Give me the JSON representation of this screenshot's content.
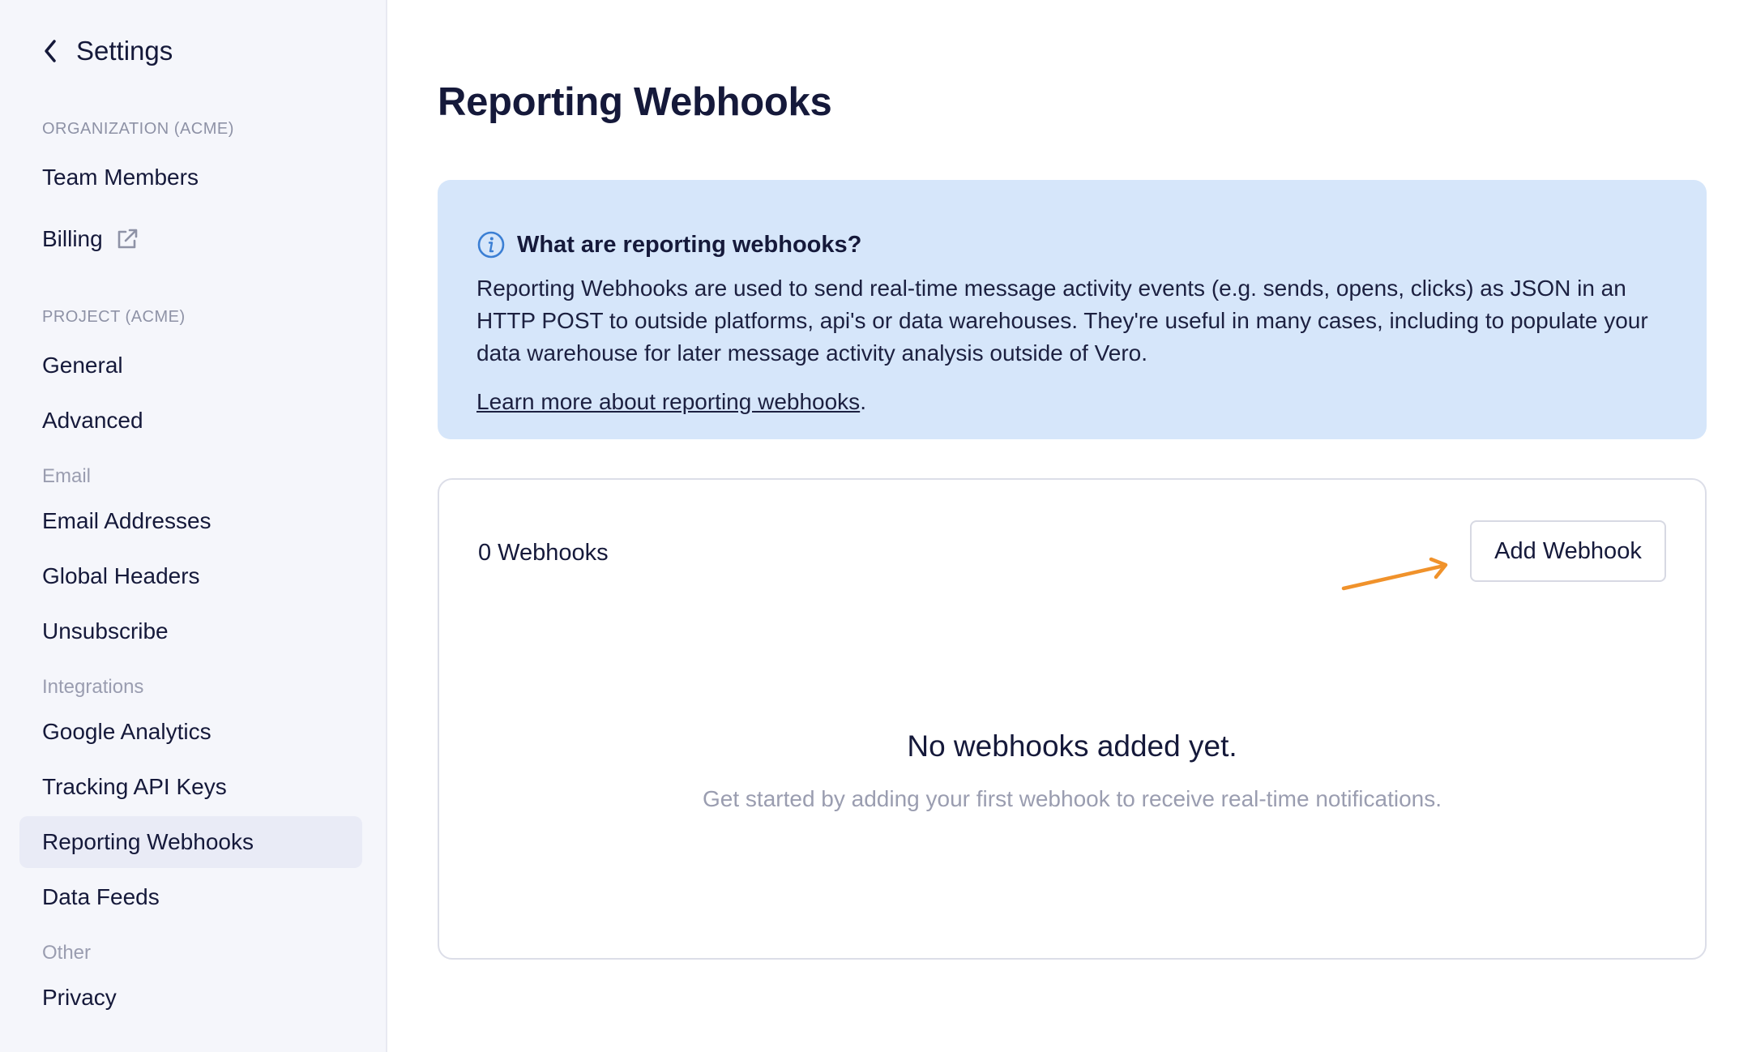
{
  "sidebar": {
    "back_title": "Settings",
    "org_label": "ORGANIZATION (ACME)",
    "org_items": [
      {
        "label": "Team Members"
      },
      {
        "label": "Billing"
      }
    ],
    "project_label": "PROJECT (ACME)",
    "project_items": [
      {
        "label": "General"
      },
      {
        "label": "Advanced"
      }
    ],
    "email_label": "Email",
    "email_items": [
      {
        "label": "Email Addresses"
      },
      {
        "label": "Global Headers"
      },
      {
        "label": "Unsubscribe"
      }
    ],
    "integrations_label": "Integrations",
    "integrations_items": [
      {
        "label": "Google Analytics"
      },
      {
        "label": "Tracking API Keys"
      },
      {
        "label": "Reporting Webhooks",
        "active": true
      },
      {
        "label": "Data Feeds"
      }
    ],
    "other_label": "Other",
    "other_items": [
      {
        "label": "Privacy"
      }
    ]
  },
  "main": {
    "title": "Reporting Webhooks",
    "info": {
      "heading": "What are reporting webhooks?",
      "body": "Reporting Webhooks are used to send real-time message activity events (e.g. sends, opens, clicks) as JSON in an HTTP POST to outside platforms, api's or data warehouses. They're useful in many cases, including to populate your data warehouse for later message activity analysis outside of Vero.",
      "link_text": "Learn more about reporting webhooks",
      "link_suffix": "."
    },
    "webhooks": {
      "count_label": "0 Webhooks",
      "add_button": "Add Webhook",
      "empty_title": "No webhooks added yet.",
      "empty_subtitle": "Get started by adding your first webhook to receive real-time notifications."
    }
  },
  "colors": {
    "sidebar_bg": "#f5f6fb",
    "info_bg": "#d6e6fa",
    "info_icon": "#3b7fd4",
    "arrow": "#f0922b",
    "text": "#15193a"
  }
}
